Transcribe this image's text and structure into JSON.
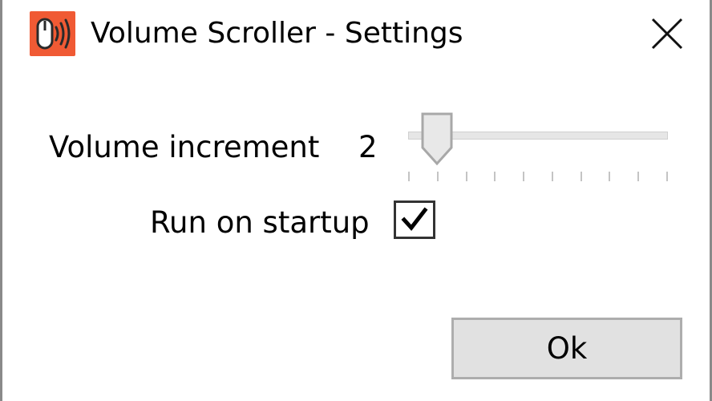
{
  "window": {
    "title": "Volume Scroller - Settings",
    "icon": "mouse-volume-icon",
    "accent_color": "#f05a34"
  },
  "settings": {
    "volume_increment": {
      "label": "Volume increment",
      "value": "2",
      "slider_min": 1,
      "slider_max": 10,
      "slider_level": 2
    },
    "run_on_startup": {
      "label": "Run on startup",
      "checked": true
    }
  },
  "buttons": {
    "ok_label": "Ok"
  }
}
